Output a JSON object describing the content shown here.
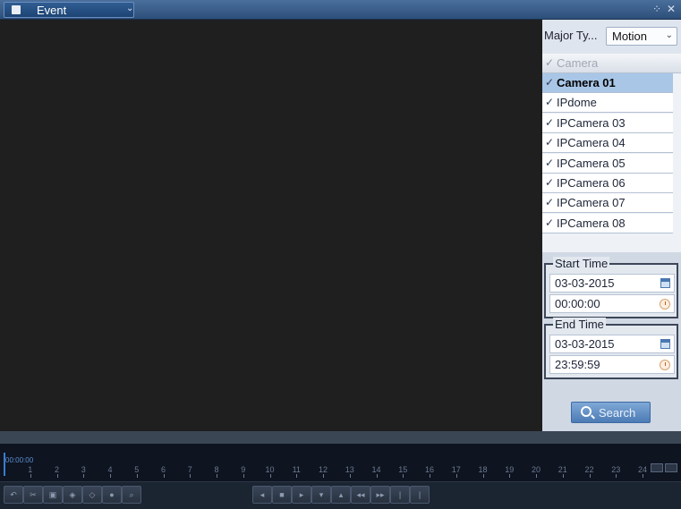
{
  "titlebar": {
    "mode_label": "Event",
    "mode_chevron": "⌄",
    "restore_icon": "⁘",
    "close_icon": "✕"
  },
  "panel": {
    "major_type_label": "Major Ty...",
    "major_type_value": "Motion",
    "camera_header": "Camera",
    "cameras": [
      {
        "label": "Camera 01",
        "checked": true,
        "selected": true
      },
      {
        "label": "IPdome",
        "checked": true,
        "selected": false
      },
      {
        "label": "IPCamera 03",
        "checked": true,
        "selected": false
      },
      {
        "label": "IPCamera 04",
        "checked": true,
        "selected": false
      },
      {
        "label": "IPCamera 05",
        "checked": true,
        "selected": false
      },
      {
        "label": "IPCamera 06",
        "checked": true,
        "selected": false
      },
      {
        "label": "IPCamera 07",
        "checked": true,
        "selected": false
      },
      {
        "label": "IPCamera 08",
        "checked": true,
        "selected": false
      }
    ],
    "start_time": {
      "legend": "Start Time",
      "date": "03-03-2015",
      "time": "00:00:00"
    },
    "end_time": {
      "legend": "End Time",
      "date": "03-03-2015",
      "time": "23:59:59"
    },
    "search_label": "Search"
  },
  "timeline": {
    "start_label": "00:00:00",
    "hours": [
      "1",
      "2",
      "3",
      "4",
      "5",
      "6",
      "7",
      "8",
      "9",
      "10",
      "11",
      "12",
      "13",
      "14",
      "15",
      "16",
      "17",
      "18",
      "19",
      "20",
      "21",
      "22",
      "23",
      "24"
    ]
  },
  "toolbar": {
    "left_icons": [
      "undo-icon",
      "cut-icon",
      "save-clip-icon",
      "tag-icon",
      "custom-tag-icon",
      "lock-icon",
      "zoom-icon"
    ],
    "center_icons": [
      "reverse-play-icon",
      "stop-icon",
      "play-icon",
      "slow-icon",
      "fast-icon",
      "previous-icon",
      "next-icon",
      "prev-segment-icon",
      "next-segment-icon"
    ]
  },
  "colors": {
    "titlebar": "#3d6391",
    "selected_row": "#a9c6e6",
    "search_button": "#6691c8",
    "timeline_cursor": "#3a7cd0"
  }
}
